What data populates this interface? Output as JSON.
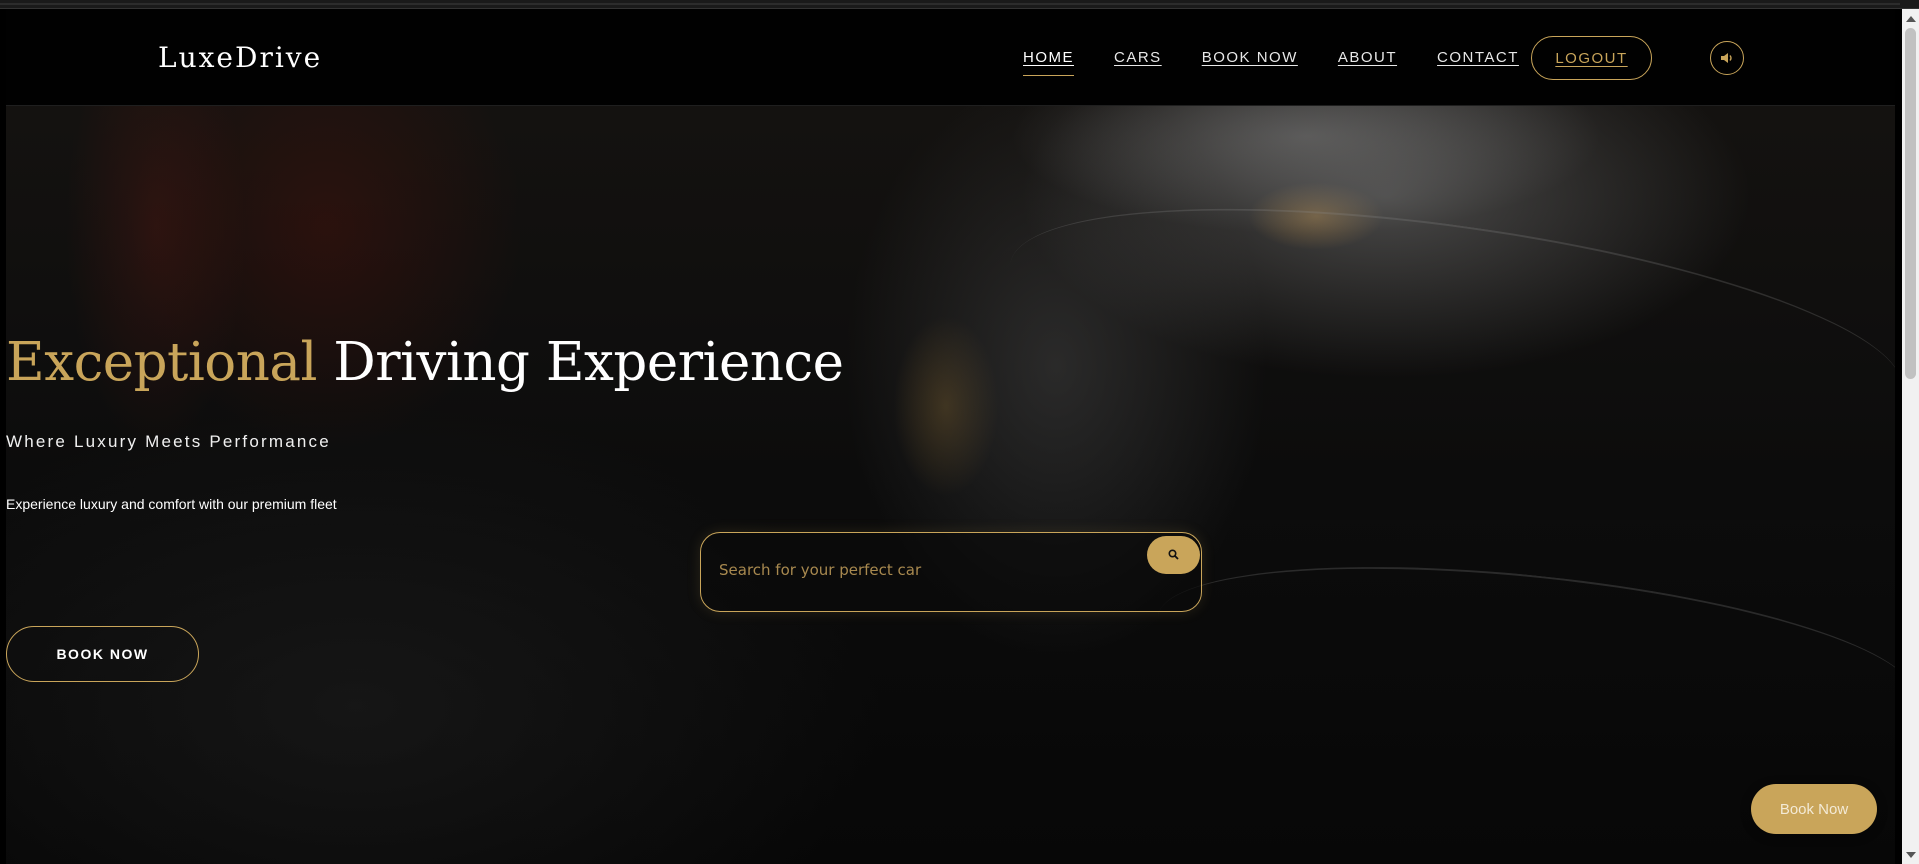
{
  "header": {
    "logo": "LuxeDrive",
    "nav": [
      {
        "label": "HOME"
      },
      {
        "label": "CARS"
      },
      {
        "label": "BOOK NOW"
      },
      {
        "label": "ABOUT"
      },
      {
        "label": "CONTACT"
      }
    ],
    "logout_label": "LOGOUT",
    "sound_icon": "volume-icon"
  },
  "hero": {
    "title_accent": "Exceptional",
    "title_rest": " Driving Experience",
    "subtitle": "Where Luxury Meets Performance",
    "description": "Experience luxury and comfort with our premium fleet",
    "book_label": "BOOK NOW"
  },
  "search": {
    "placeholder": "Search for your perfect car",
    "icon": "search-icon"
  },
  "floating": {
    "book_label": "Book Now"
  },
  "colors": {
    "accent": "#c9a55a",
    "background": "#000000",
    "text": "#ffffff"
  }
}
